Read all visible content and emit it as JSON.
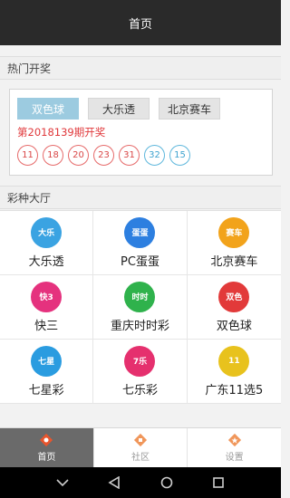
{
  "header": {
    "title": "首页"
  },
  "hot_draws": {
    "section_title": "热门开奖",
    "tabs": [
      {
        "label": "双色球",
        "active": true
      },
      {
        "label": "大乐透",
        "active": false
      },
      {
        "label": "北京赛车",
        "active": false
      }
    ],
    "issue": "第2018139期开奖",
    "red_balls": [
      "11",
      "18",
      "20",
      "23",
      "31"
    ],
    "blue_balls": [
      "32",
      "15"
    ]
  },
  "hall": {
    "section_title": "彩种大厅",
    "items": [
      {
        "name": "大乐透",
        "icon": "daletou-icon",
        "color": "#3aa3e2",
        "glyph": "大乐"
      },
      {
        "name": "PC蛋蛋",
        "icon": "pcdandan-icon",
        "color": "#2d7fe0",
        "glyph": "蛋蛋"
      },
      {
        "name": "北京赛车",
        "icon": "bjsaiche-icon",
        "color": "#f2a31b",
        "glyph": "赛车"
      },
      {
        "name": "快三",
        "icon": "kuaisan-icon",
        "color": "#e5327e",
        "glyph": "快3"
      },
      {
        "name": "重庆时时彩",
        "icon": "cqssc-icon",
        "color": "#2fb24c",
        "glyph": "时时"
      },
      {
        "name": "双色球",
        "icon": "shuangseqiu-icon",
        "color": "#e23a3a",
        "glyph": "双色"
      },
      {
        "name": "七星彩",
        "icon": "qixingcai-icon",
        "color": "#2a9ce0",
        "glyph": "七星"
      },
      {
        "name": "七乐彩",
        "icon": "qilecai-icon",
        "color": "#e5306e",
        "glyph": "7乐"
      },
      {
        "name": "广东11选5",
        "icon": "gd11x5-icon",
        "color": "#e8c21d",
        "glyph": "11"
      }
    ]
  },
  "tabbar": [
    {
      "label": "首页",
      "icon": "home-icon",
      "active": true
    },
    {
      "label": "社区",
      "icon": "community-icon",
      "active": false
    },
    {
      "label": "设置",
      "icon": "settings-icon",
      "active": false
    }
  ],
  "colors": {
    "accent": "#e0383b",
    "tab_active": "#9ccbe0",
    "blue_ball": "#5eb7dc"
  }
}
